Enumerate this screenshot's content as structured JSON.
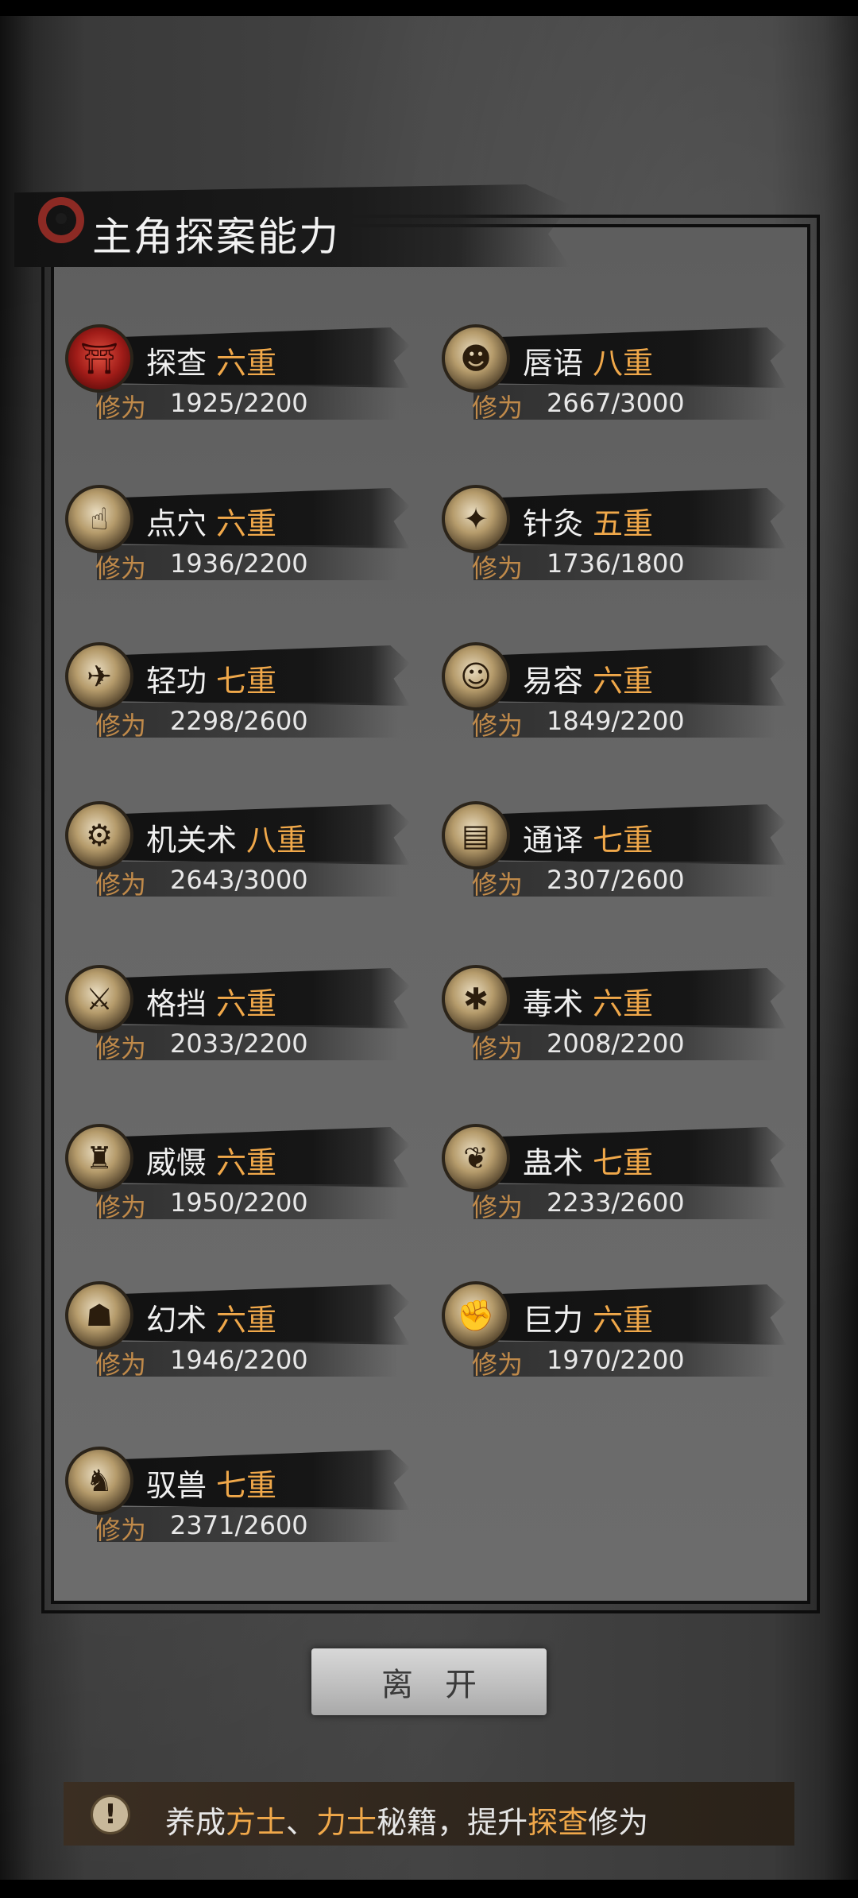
{
  "title": "主角探案能力",
  "xp_label": "修为",
  "skills": [
    {
      "name": "探查",
      "level": "六重",
      "xp": "1925/2200",
      "icon": "lantern-icon",
      "icon_glyph": "⛩",
      "red": true
    },
    {
      "name": "唇语",
      "level": "八重",
      "xp": "2667/3000",
      "icon": "face-icon",
      "icon_glyph": "☻"
    },
    {
      "name": "点穴",
      "level": "六重",
      "xp": "1936/2200",
      "icon": "finger-point-icon",
      "icon_glyph": "☝"
    },
    {
      "name": "针灸",
      "level": "五重",
      "xp": "1736/1800",
      "icon": "needle-icon",
      "icon_glyph": "✦"
    },
    {
      "name": "轻功",
      "level": "七重",
      "xp": "2298/2600",
      "icon": "flying-figure-icon",
      "icon_glyph": "✈"
    },
    {
      "name": "易容",
      "level": "六重",
      "xp": "1849/2200",
      "icon": "mask-icon",
      "icon_glyph": "☺"
    },
    {
      "name": "机关术",
      "level": "八重",
      "xp": "2643/3000",
      "icon": "gear-icon",
      "icon_glyph": "⚙"
    },
    {
      "name": "通译",
      "level": "七重",
      "xp": "2307/2600",
      "icon": "scroll-icon",
      "icon_glyph": "▤"
    },
    {
      "name": "格挡",
      "level": "六重",
      "xp": "2033/2200",
      "icon": "block-icon",
      "icon_glyph": "⚔"
    },
    {
      "name": "毒术",
      "level": "六重",
      "xp": "2008/2200",
      "icon": "spider-icon",
      "icon_glyph": "✱"
    },
    {
      "name": "威慑",
      "level": "六重",
      "xp": "1950/2200",
      "icon": "warrior-icon",
      "icon_glyph": "♜"
    },
    {
      "name": "蛊术",
      "level": "七重",
      "xp": "2233/2600",
      "icon": "worm-icon",
      "icon_glyph": "❦"
    },
    {
      "name": "幻术",
      "level": "六重",
      "xp": "1946/2200",
      "icon": "hooded-figure-icon",
      "icon_glyph": "☗"
    },
    {
      "name": "巨力",
      "level": "六重",
      "xp": "1970/2200",
      "icon": "fist-icon",
      "icon_glyph": "✊"
    },
    {
      "name": "驭兽",
      "level": "七重",
      "xp": "2371/2600",
      "icon": "wolf-icon",
      "icon_glyph": "♞"
    }
  ],
  "leave_button": "离开",
  "tip": {
    "icon": "exclamation-icon",
    "icon_glyph": "!",
    "parts": [
      "养成",
      "方士",
      "、",
      "力士",
      "秘籍，提升",
      "探查",
      "修为"
    ]
  },
  "colors": {
    "highlight": "#f0a84a",
    "xp_label": "#c08a4a",
    "text": "#f0f0f0"
  }
}
